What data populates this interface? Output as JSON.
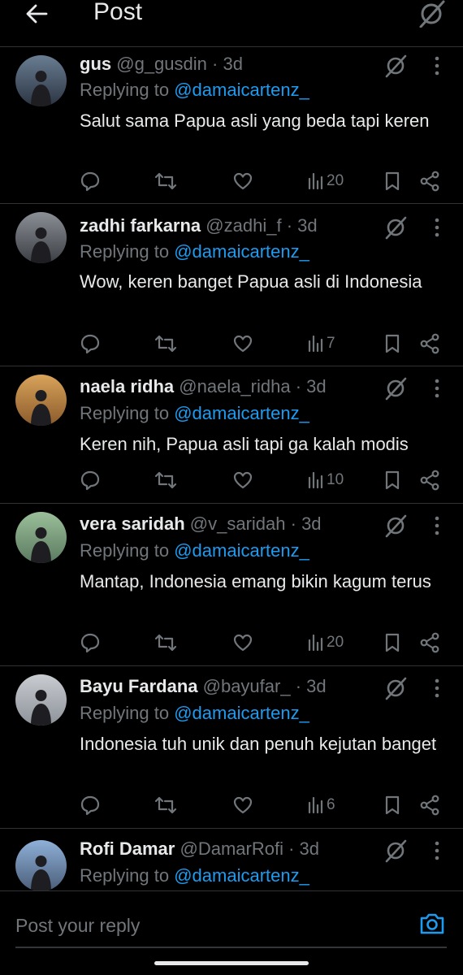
{
  "header": {
    "title": "Post"
  },
  "replies": [
    {
      "name": "gus",
      "handle": "@g_gusdin",
      "time": "· 3d",
      "replying_label": "Replying to",
      "replying_to": "@damaicartenz_",
      "text": "Salut sama Papua asli yang beda tapi keren",
      "views": "20",
      "avatar_colors": [
        "#6a7d92",
        "#2b3442"
      ]
    },
    {
      "name": "zadhi farkarna",
      "handle": "@zadhi_f",
      "time": "· 3d",
      "replying_label": "Replying to",
      "replying_to": "@damaicartenz_",
      "text": "Wow, keren banget Papua asli di Indonesia",
      "views": "7",
      "avatar_colors": [
        "#8b8f96",
        "#3b3f44"
      ]
    },
    {
      "name": "naela ridha",
      "handle": "@naela_ridha",
      "time": "· 3d",
      "replying_label": "Replying to",
      "replying_to": "@damaicartenz_",
      "text": "Keren nih, Papua asli tapi ga kalah modis",
      "views": "10",
      "avatar_colors": [
        "#d9a35a",
        "#8a5a2b"
      ]
    },
    {
      "name": "vera saridah",
      "handle": "@v_saridah",
      "time": "· 3d",
      "replying_label": "Replying to",
      "replying_to": "@damaicartenz_",
      "text": "Mantap, Indonesia emang bikin kagum terus",
      "views": "20",
      "avatar_colors": [
        "#9bbf9a",
        "#5a7a60"
      ]
    },
    {
      "name": "Bayu Fardana",
      "handle": "@bayufar_",
      "time": "· 3d",
      "replying_label": "Replying to",
      "replying_to": "@damaicartenz_",
      "text": "Indonesia tuh unik dan penuh kejutan banget",
      "views": "6",
      "avatar_colors": [
        "#c9ccd1",
        "#8d9299"
      ]
    },
    {
      "name": "Rofi Damar",
      "handle": "@DamarRofi",
      "time": "· 3d",
      "replying_label": "Replying to",
      "replying_to": "@damaicartenz_",
      "text": "",
      "views": "",
      "avatar_colors": [
        "#8fb0d8",
        "#4a5d78"
      ]
    }
  ],
  "composer": {
    "placeholder": "Post your reply"
  },
  "colors": {
    "background": "#000000",
    "text": "#e7e9ea",
    "secondary": "#71767b",
    "accent": "#1d9bf0",
    "divider": "#2f3336"
  },
  "icons": {
    "back": "arrow-left-icon",
    "grok": "grok-icon",
    "more": "more-vertical-icon",
    "reply": "reply-icon",
    "repost": "repost-icon",
    "like": "heart-icon",
    "views": "views-icon",
    "bookmark": "bookmark-icon",
    "share": "share-icon",
    "camera": "camera-icon"
  }
}
